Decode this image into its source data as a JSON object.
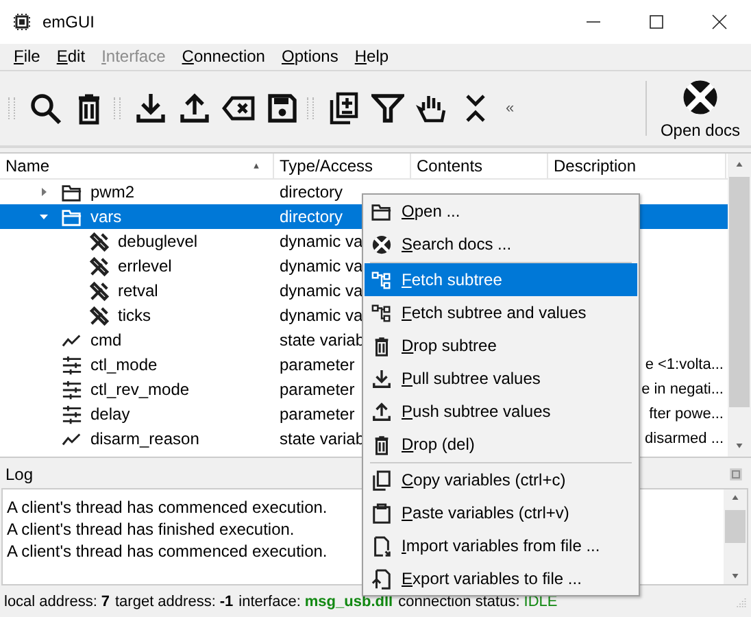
{
  "window": {
    "title": "emGUI"
  },
  "menu_bar": [
    {
      "label": "File",
      "disabled": false
    },
    {
      "label": "Edit",
      "disabled": false
    },
    {
      "label": "Interface",
      "disabled": true
    },
    {
      "label": "Connection",
      "disabled": false
    },
    {
      "label": "Options",
      "disabled": false
    },
    {
      "label": "Help",
      "disabled": false
    }
  ],
  "toolbar": {
    "overflow": "«",
    "docs_button": "Open docs"
  },
  "tree": {
    "columns": [
      {
        "label": "Name",
        "sorted": true
      },
      {
        "label": "Type/Access",
        "sorted": false
      },
      {
        "label": "Contents",
        "sorted": false
      },
      {
        "label": "Description",
        "sorted": false
      }
    ],
    "rows": [
      {
        "name": "pwm2",
        "type": "directory",
        "kind": "directory",
        "expanded": false,
        "selected": false,
        "children": []
      },
      {
        "name": "vars",
        "type": "directory",
        "kind": "directory",
        "expanded": true,
        "selected": true,
        "children": [
          {
            "name": "debuglevel",
            "type": "dynamic va",
            "kind": "dynamic",
            "selected": false
          },
          {
            "name": "errlevel",
            "type": "dynamic va",
            "kind": "dynamic",
            "selected": false
          },
          {
            "name": "retval",
            "type": "dynamic va",
            "kind": "dynamic",
            "selected": false
          },
          {
            "name": "ticks",
            "type": "dynamic va",
            "kind": "dynamic",
            "selected": false
          }
        ]
      },
      {
        "name": "cmd",
        "type": "state variab",
        "kind": "state",
        "selected": false
      },
      {
        "name": "ctl_mode",
        "type": "parameter",
        "kind": "parameter",
        "description": "e <1:volta...",
        "selected": false
      },
      {
        "name": "ctl_rev_mode",
        "type": "parameter",
        "kind": "parameter",
        "description": "e in negati...",
        "selected": false
      },
      {
        "name": "delay",
        "type": "parameter",
        "kind": "parameter",
        "description": "fter powe...",
        "selected": false
      },
      {
        "name": "disarm_reason",
        "type": "state variab",
        "kind": "state",
        "description": "disarmed ...",
        "selected": false
      }
    ]
  },
  "context_menu": [
    {
      "kind": "open",
      "label": "Open ...",
      "selected": false
    },
    {
      "kind": "docs",
      "label": "Search docs ...",
      "selected": false
    },
    {
      "kind": "separator"
    },
    {
      "kind": "fetch",
      "label": "Fetch subtree",
      "selected": true
    },
    {
      "kind": "fetch",
      "label": "Fetch subtree and values",
      "selected": false
    },
    {
      "kind": "drop",
      "label": "Drop subtree",
      "selected": false
    },
    {
      "kind": "pull",
      "label": "Pull subtree values",
      "selected": false
    },
    {
      "kind": "push",
      "label": "Push subtree values",
      "selected": false
    },
    {
      "kind": "drop",
      "label": "Drop (del)",
      "selected": false
    },
    {
      "kind": "separator"
    },
    {
      "kind": "copy",
      "label": "Copy variables (ctrl+c)",
      "selected": false
    },
    {
      "kind": "paste",
      "label": "Paste variables (ctrl+v)",
      "selected": false
    },
    {
      "kind": "import",
      "label": "Import variables from file ...",
      "selected": false
    },
    {
      "kind": "export",
      "label": "Export variables to file ...",
      "selected": false
    }
  ],
  "log": {
    "title": "Log",
    "lines": [
      "A client's thread has commenced execution.",
      "A client's thread has finished execution.",
      "A client's thread has commenced execution."
    ]
  },
  "status_bar": [
    {
      "label": "local address:",
      "value": "7"
    },
    {
      "label": "target address:",
      "value": "-1"
    },
    {
      "label": "interface:",
      "value": "msg_usb.dll"
    },
    {
      "label": "connection status:",
      "value": "IDLE"
    }
  ]
}
